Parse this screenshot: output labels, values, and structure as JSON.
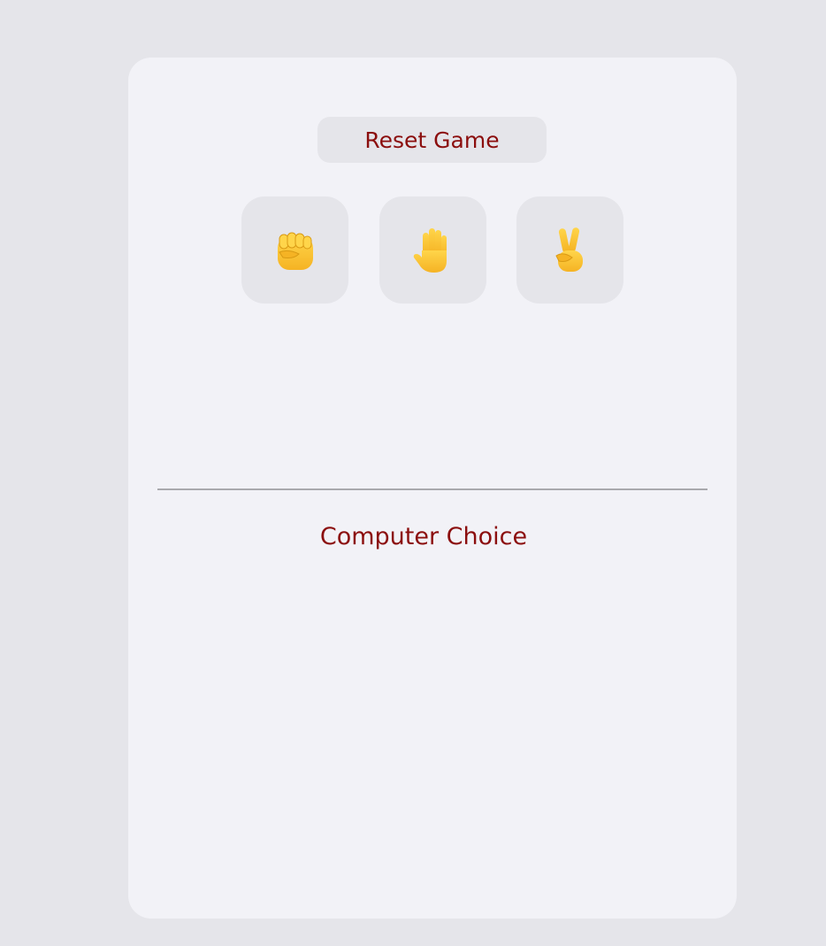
{
  "game": {
    "reset_label": "Reset Game",
    "computer_choice_label": "Computer Choice"
  },
  "choices": [
    {
      "name": "rock",
      "icon": "raised-fist-icon"
    },
    {
      "name": "paper",
      "icon": "raised-hand-icon"
    },
    {
      "name": "scissors",
      "icon": "victory-hand-icon"
    }
  ],
  "colors": {
    "background": "#e5e5ea",
    "card": "#f2f2f7",
    "button": "#e5e5ea",
    "accent_text": "#8b0e0e",
    "emoji_yellow": "#f7c531"
  }
}
